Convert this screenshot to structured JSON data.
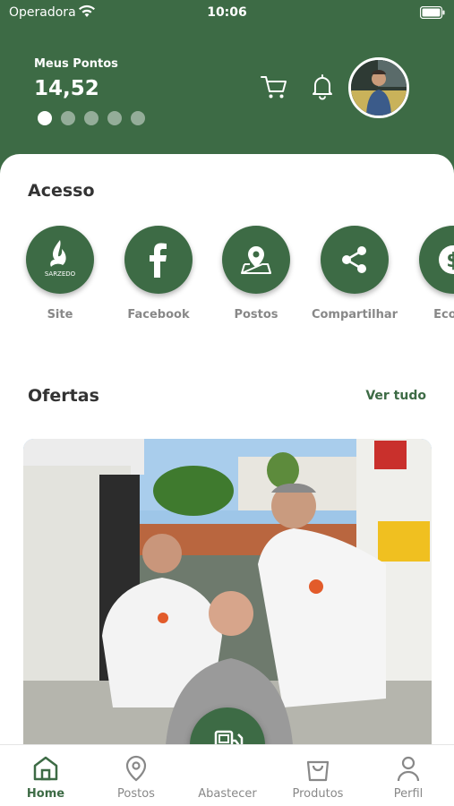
{
  "status": {
    "carrier": "Operadora",
    "time": "10:06"
  },
  "header": {
    "points_label": "Meus Pontos",
    "points_value": "14,52",
    "carousel_pages": 5,
    "active_page": 0
  },
  "access": {
    "title": "Acesso",
    "items": [
      {
        "label": "Site",
        "icon": "sarzedo-logo-icon",
        "logo_text": "SARZEDO"
      },
      {
        "label": "Facebook",
        "icon": "facebook-icon"
      },
      {
        "label": "Postos",
        "icon": "map-pin-icon"
      },
      {
        "label": "Compartilhar",
        "icon": "share-icon"
      },
      {
        "label": "Econo",
        "icon": "dollar-icon"
      }
    ]
  },
  "offers": {
    "title": "Ofertas",
    "see_all": "Ver tudo"
  },
  "tabs": [
    {
      "label": "Home",
      "icon": "home-icon",
      "active": true
    },
    {
      "label": "Postos",
      "icon": "map-pin-icon"
    },
    {
      "label": "Abastecer",
      "icon": "fuel-pump-icon"
    },
    {
      "label": "Produtos",
      "icon": "shopping-bag-icon"
    },
    {
      "label": "Perfil",
      "icon": "user-icon"
    }
  ],
  "colors": {
    "primary": "#3d6b45",
    "text_muted": "#888888",
    "title": "#333333"
  }
}
